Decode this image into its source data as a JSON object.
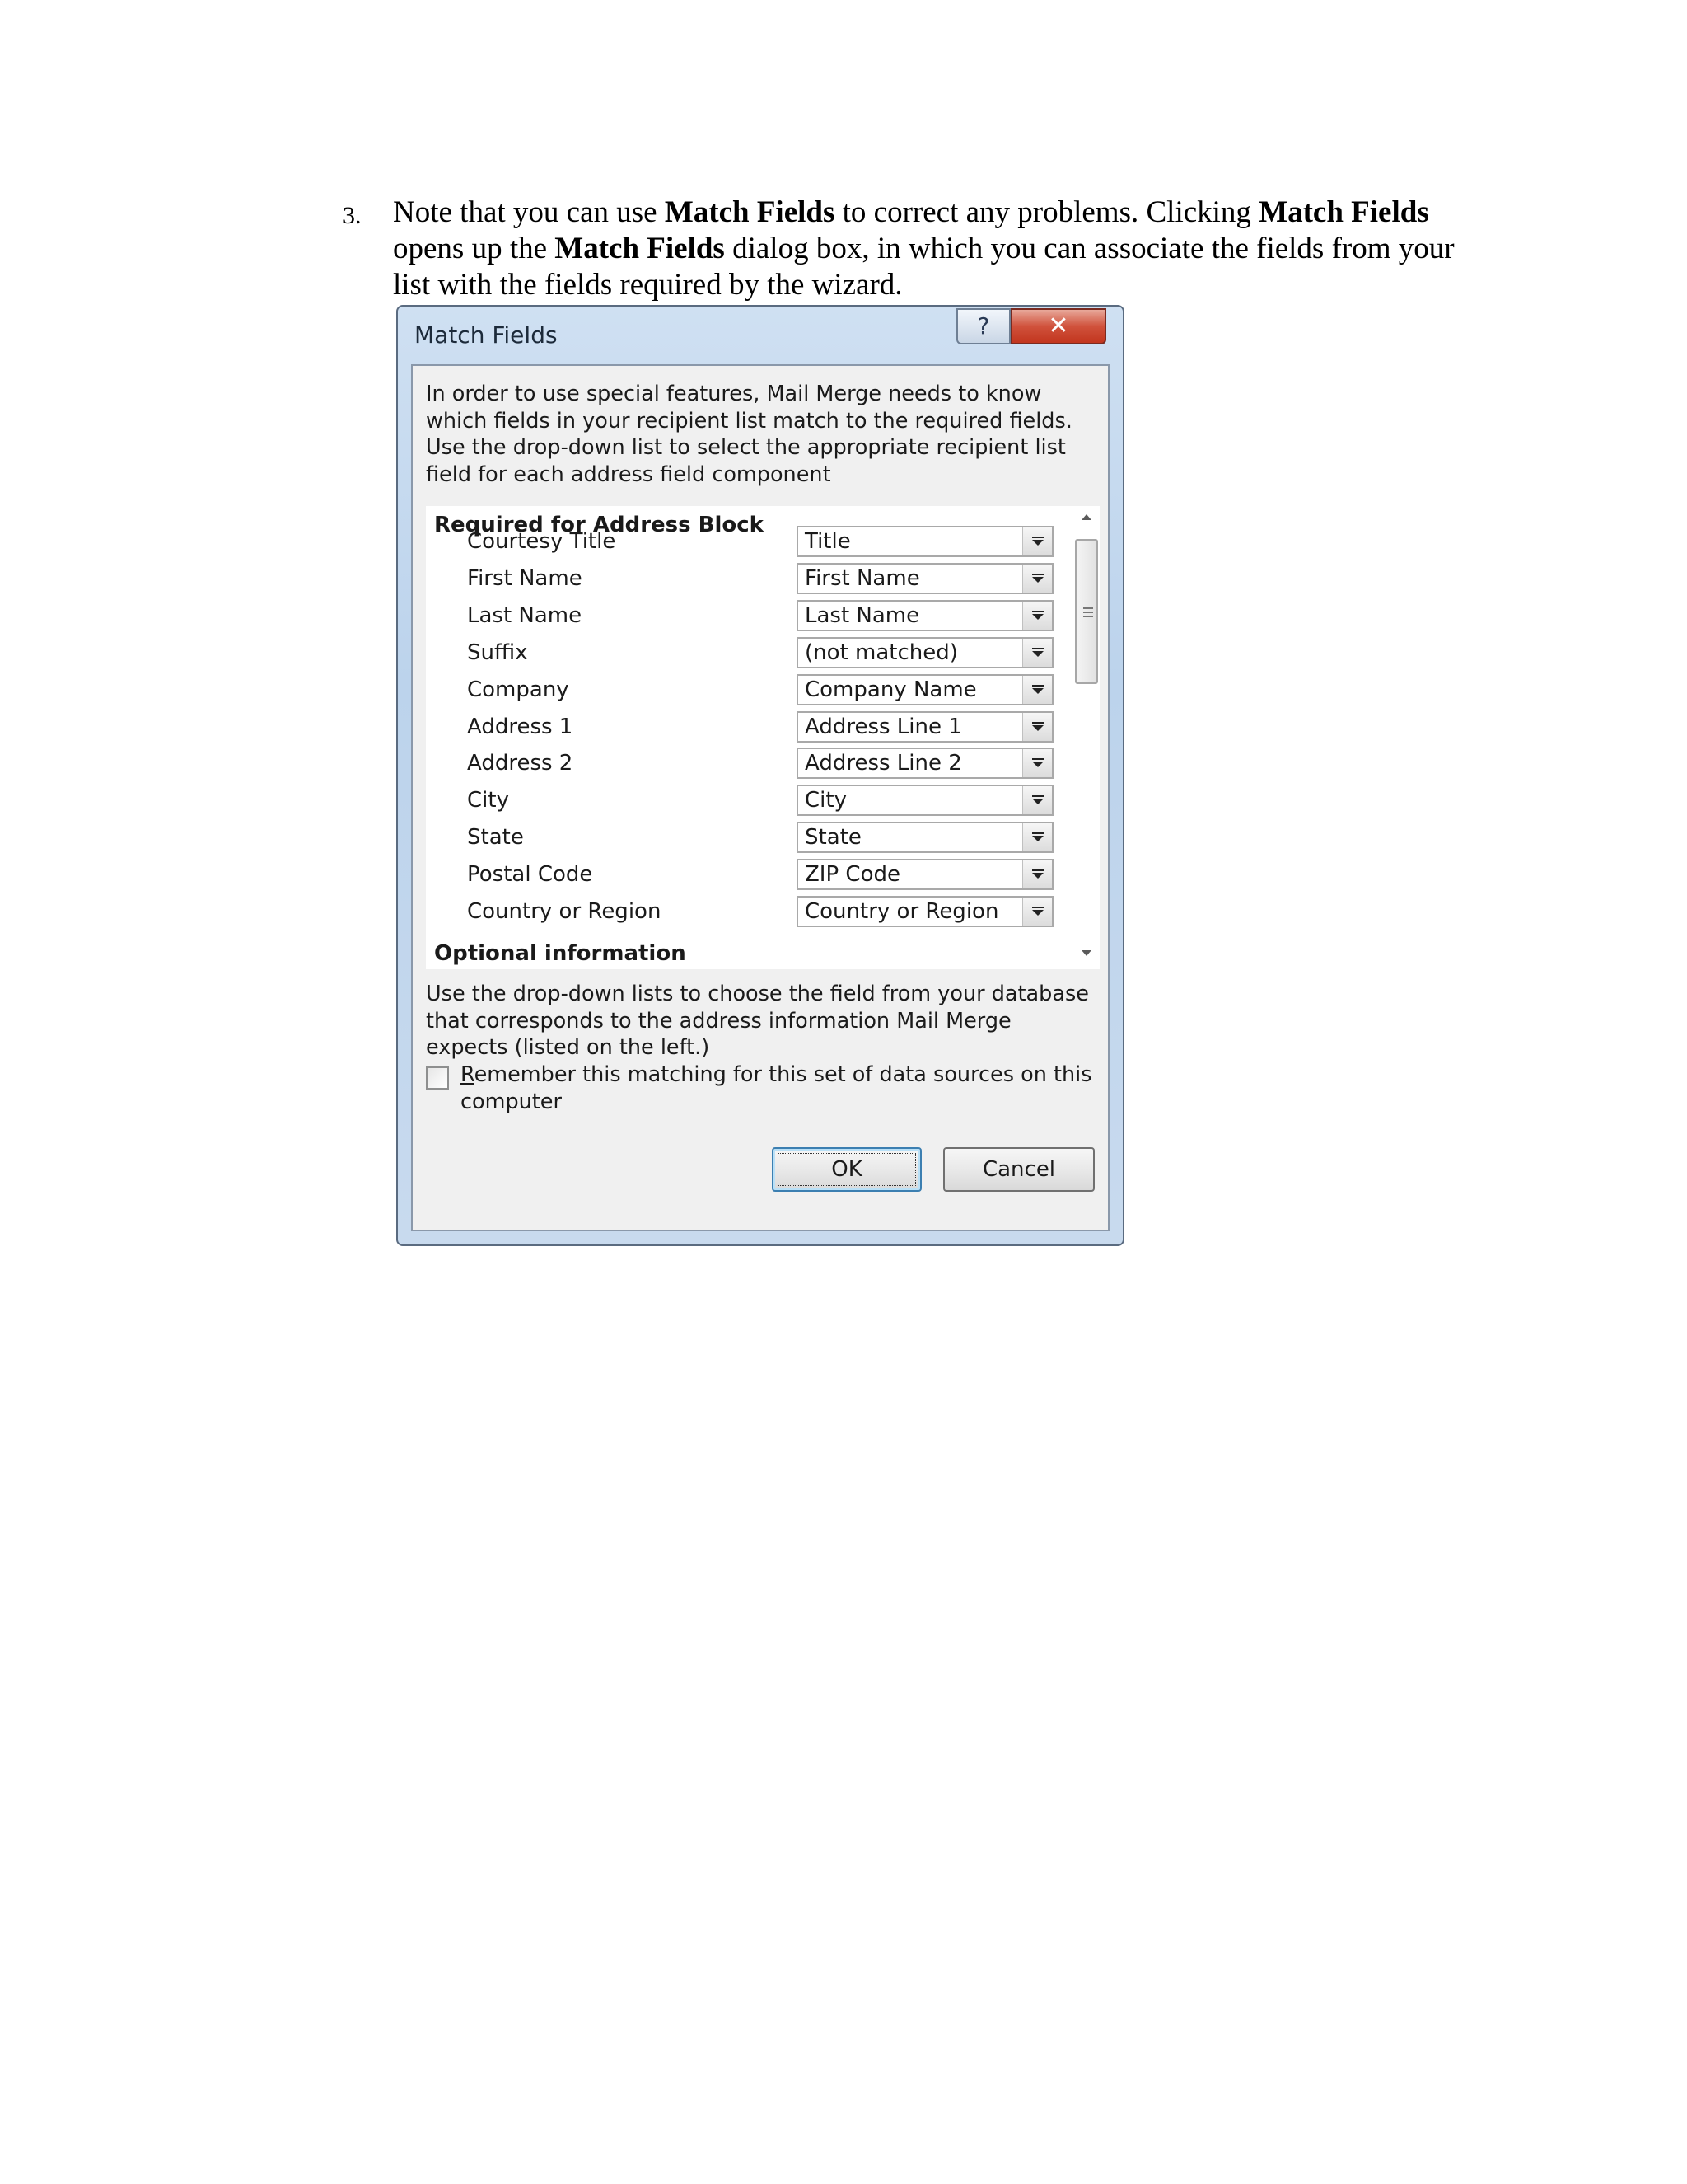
{
  "instruction": {
    "number": "3.",
    "parts": [
      {
        "text": "Note that you can use ",
        "bold": false
      },
      {
        "text": "Match Fields",
        "bold": true
      },
      {
        "text": " to correct any problems. Clicking ",
        "bold": false
      },
      {
        "text": "Match Fields",
        "bold": true
      },
      {
        "text": " opens up the ",
        "bold": false
      },
      {
        "text": "Match Fields",
        "bold": true
      },
      {
        "text": " dialog box, in which you can associate the fields from your list with the fields required by the wizard.",
        "bold": false
      }
    ]
  },
  "dialog": {
    "title": "Match Fields",
    "help_glyph": "?",
    "close_glyph": "✕",
    "intro": "In order to use special features, Mail Merge needs to know\nwhich fields in your recipient list match to the required fields.\nUse the drop-down list to select the appropriate recipient list\nfield for each address field component",
    "required_header": "Required for Address Block",
    "fields": [
      {
        "label": "Courtesy Title",
        "value": "Title"
      },
      {
        "label": "First Name",
        "value": "First Name"
      },
      {
        "label": "Last Name",
        "value": "Last Name"
      },
      {
        "label": "Suffix",
        "value": "(not matched)"
      },
      {
        "label": "Company",
        "value": "Company Name"
      },
      {
        "label": "Address 1",
        "value": "Address Line 1"
      },
      {
        "label": "Address 2",
        "value": "Address Line 2"
      },
      {
        "label": "City",
        "value": "City"
      },
      {
        "label": "State",
        "value": "State"
      },
      {
        "label": "Postal Code",
        "value": "ZIP Code"
      },
      {
        "label": "Country or Region",
        "value": "Country or Region"
      }
    ],
    "optional_header": "Optional information",
    "outro": "Use the drop-down lists to choose the field from your database\nthat corresponds to the address information Mail Merge\nexpects (listed on the left.)",
    "remember": {
      "accel": "R",
      "rest": "emember this matching for this set of data sources on this computer",
      "checked": false
    },
    "ok_label": "OK",
    "cancel_label": "Cancel"
  }
}
